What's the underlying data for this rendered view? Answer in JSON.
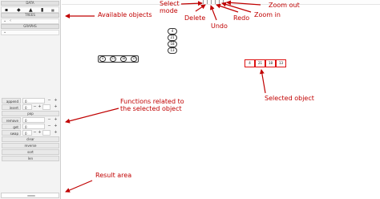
{
  "sidebar": {
    "sections": {
      "data": "DATA",
      "trees": "TREES",
      "graphs": "GRAPHS"
    },
    "data_tools": [
      "list-icon",
      "stack-icon",
      "queue-icon",
      "bookmark-icon",
      "grid-icon"
    ],
    "functions": [
      {
        "name": "append",
        "value": "0"
      },
      {
        "name": "insert",
        "value": "0"
      },
      {
        "name": "pop",
        "value": ""
      },
      {
        "name": "remove",
        "value": "0"
      },
      {
        "name": "get",
        "value": "0"
      },
      {
        "name": "swap",
        "value": "0"
      }
    ],
    "actions": [
      "clear",
      "reverse",
      "sort",
      "len"
    ]
  },
  "canvas": {
    "vertical_list": [
      "4",
      "21",
      "18",
      "13"
    ],
    "horizontal_list": [
      "4",
      "21",
      "18",
      "13"
    ],
    "selected_list": [
      "4",
      "21",
      "18",
      "13"
    ]
  },
  "annotations": {
    "available_objects": "Available objects",
    "select_mode": "Select\nmode",
    "delete": "Delete",
    "undo": "Undo",
    "redo": "Redo",
    "zoom_out": "Zoom out",
    "zoom_in": "Zoom in",
    "functions_related": "Functions related to\nthe selected object",
    "selected_object": "Selected object",
    "result_area": "Result area"
  },
  "colors": {
    "annotation": "#c00000",
    "selected_border": "#dd1111"
  }
}
